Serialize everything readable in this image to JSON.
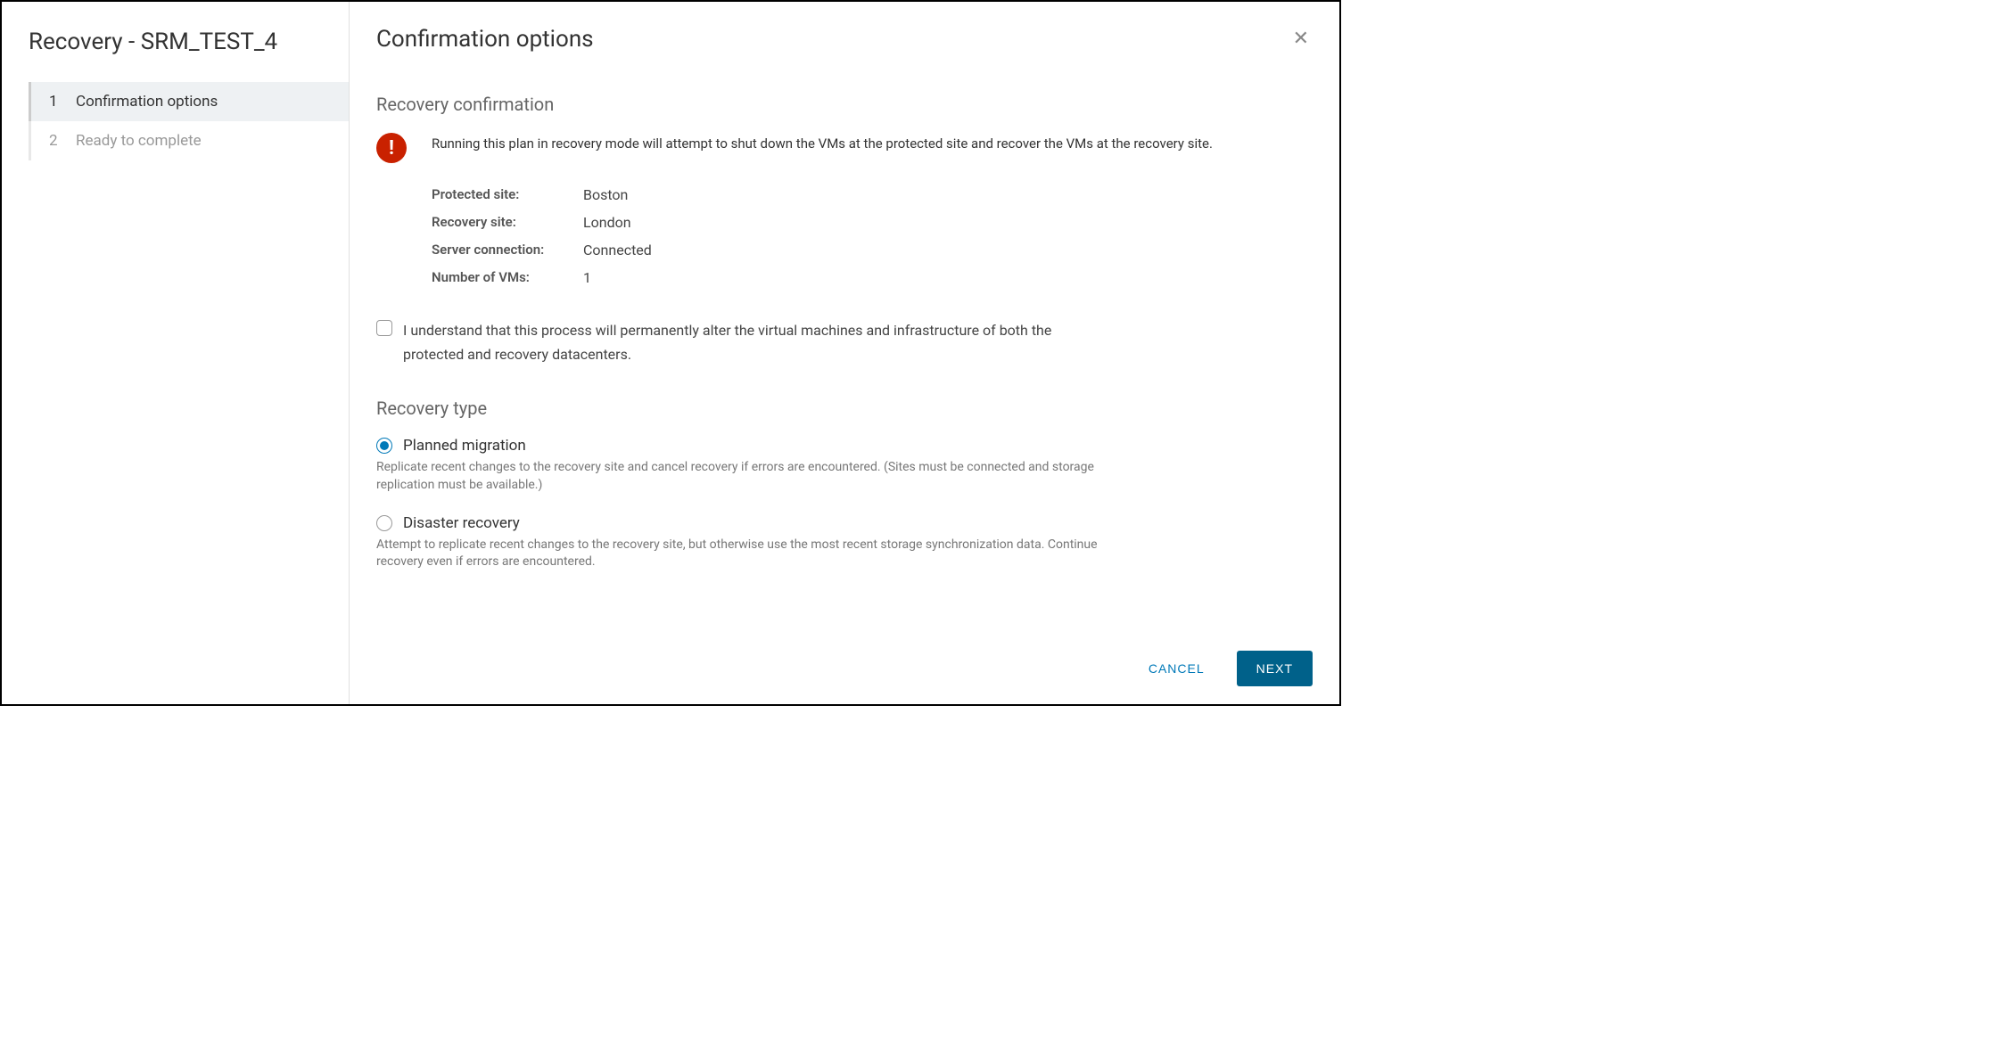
{
  "sidebar": {
    "title": "Recovery - SRM_TEST_4",
    "steps": [
      {
        "num": "1",
        "label": "Confirmation options",
        "active": true
      },
      {
        "num": "2",
        "label": "Ready to complete",
        "active": false
      }
    ]
  },
  "header": {
    "title": "Confirmation options"
  },
  "confirmation": {
    "section_title": "Recovery confirmation",
    "alert_text": "Running this plan in recovery mode will attempt to shut down the VMs at the protected site and recover the VMs at the recovery site.",
    "rows": {
      "protected_site": {
        "label": "Protected site:",
        "value": "Boston"
      },
      "recovery_site": {
        "label": "Recovery site:",
        "value": "London"
      },
      "server_connection": {
        "label": "Server connection:",
        "value": "Connected"
      },
      "number_of_vms": {
        "label": "Number of VMs:",
        "value": "1"
      }
    },
    "ack_text": "I understand that this process will permanently alter the virtual machines and infrastructure of both the protected and recovery datacenters."
  },
  "recovery_type": {
    "section_title": "Recovery type",
    "options": {
      "planned": {
        "label": "Planned migration",
        "desc": "Replicate recent changes to the recovery site and cancel recovery if errors are encountered. (Sites must be connected and storage replication must be available.)",
        "selected": true
      },
      "disaster": {
        "label": "Disaster recovery",
        "desc": "Attempt to replicate recent changes to the recovery site, but otherwise use the most recent storage synchronization data. Continue recovery even if errors are encountered.",
        "selected": false
      }
    }
  },
  "footer": {
    "cancel": "CANCEL",
    "next": "NEXT"
  }
}
